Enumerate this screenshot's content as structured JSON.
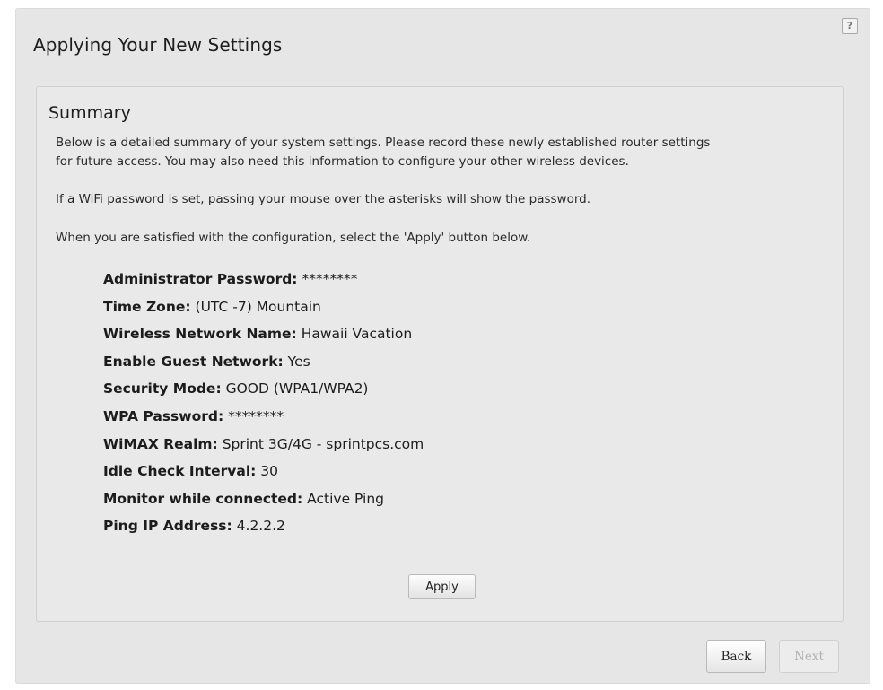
{
  "page": {
    "title": "Applying Your New Settings",
    "help_glyph": "?"
  },
  "summary": {
    "heading": "Summary",
    "intro_line1": "Below is a detailed summary of your system settings. Please record these newly established router settings",
    "intro_line2": "for future access. You may also need this information to configure your other wireless devices.",
    "password_note": "If a WiFi password is set, passing your mouse over the asterisks will show the password.",
    "apply_note": "When you are satisfied with the configuration, select the 'Apply' button below.",
    "settings": [
      {
        "label": "Administrator Password:",
        "value": "********"
      },
      {
        "label": "Time Zone:",
        "value": "(UTC -7) Mountain"
      },
      {
        "label": "Wireless Network Name:",
        "value": "Hawaii Vacation"
      },
      {
        "label": "Enable Guest Network:",
        "value": "Yes"
      },
      {
        "label": "Security Mode:",
        "value": "GOOD (WPA1/WPA2)"
      },
      {
        "label": "WPA Password:",
        "value": "********"
      },
      {
        "label": "WiMAX Realm:",
        "value": "Sprint 3G/4G - sprintpcs.com"
      },
      {
        "label": "Idle Check Interval:",
        "value": "30"
      },
      {
        "label": "Monitor while connected:",
        "value": "Active Ping"
      },
      {
        "label": "Ping IP Address:",
        "value": "4.2.2.2"
      }
    ],
    "apply_label": "Apply"
  },
  "footer": {
    "back_label": "Back",
    "next_label": "Next"
  }
}
